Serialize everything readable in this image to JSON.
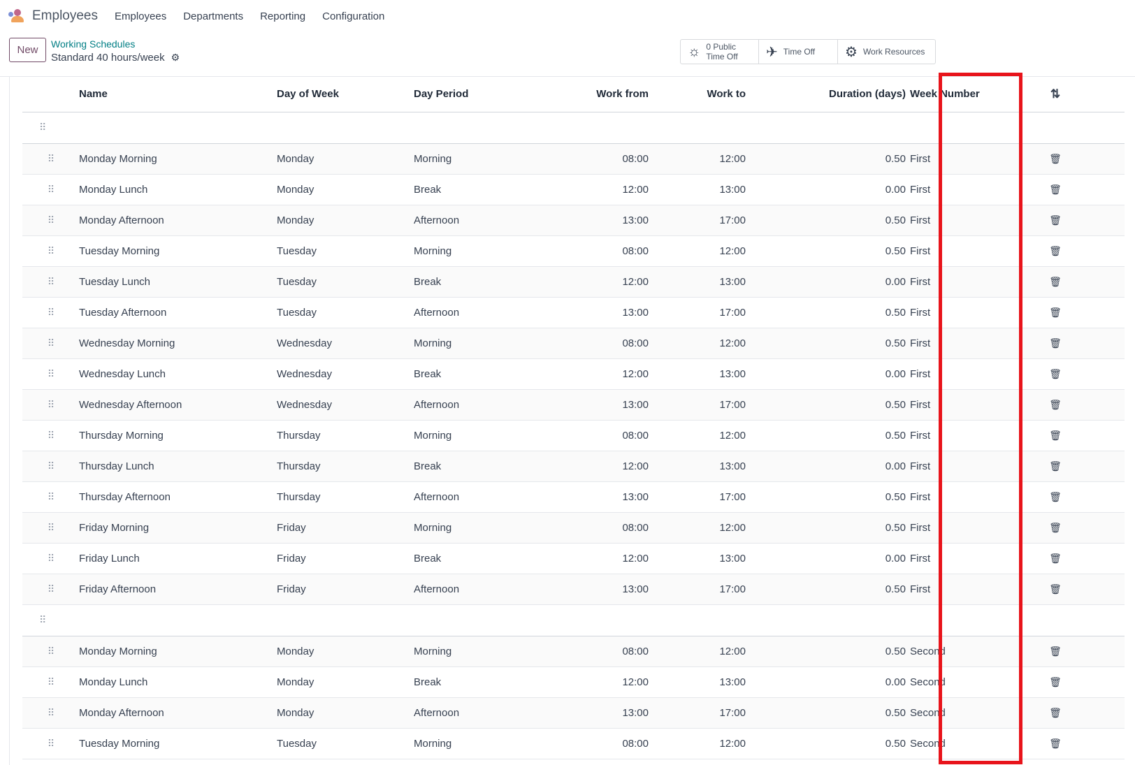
{
  "topnav": {
    "app_icon": "employees-app-icon",
    "app_name": "Employees",
    "menu": [
      "Employees",
      "Departments",
      "Reporting",
      "Configuration"
    ]
  },
  "control_panel": {
    "new_label": "New",
    "breadcrumb_parent": "Working Schedules",
    "breadcrumb_current": "Standard 40 hours/week",
    "smart_buttons": {
      "public_time_off_count": "0",
      "public_time_off_label1": "Public",
      "public_time_off_label2": "Time Off",
      "time_off_label": "Time Off",
      "work_resources_label": "Work Resources"
    }
  },
  "table": {
    "headers": [
      "Name",
      "Day of Week",
      "Day Period",
      "Work from",
      "Work to",
      "Duration (days)",
      "Week Number"
    ],
    "rows": [
      {
        "section": true
      },
      {
        "name": "Monday Morning",
        "day": "Monday",
        "period": "Morning",
        "from": "08:00",
        "to": "12:00",
        "duration": "0.50",
        "week": "First"
      },
      {
        "name": "Monday Lunch",
        "day": "Monday",
        "period": "Break",
        "from": "12:00",
        "to": "13:00",
        "duration": "0.00",
        "week": "First"
      },
      {
        "name": "Monday Afternoon",
        "day": "Monday",
        "period": "Afternoon",
        "from": "13:00",
        "to": "17:00",
        "duration": "0.50",
        "week": "First"
      },
      {
        "name": "Tuesday Morning",
        "day": "Tuesday",
        "period": "Morning",
        "from": "08:00",
        "to": "12:00",
        "duration": "0.50",
        "week": "First"
      },
      {
        "name": "Tuesday Lunch",
        "day": "Tuesday",
        "period": "Break",
        "from": "12:00",
        "to": "13:00",
        "duration": "0.00",
        "week": "First"
      },
      {
        "name": "Tuesday Afternoon",
        "day": "Tuesday",
        "period": "Afternoon",
        "from": "13:00",
        "to": "17:00",
        "duration": "0.50",
        "week": "First"
      },
      {
        "name": "Wednesday Morning",
        "day": "Wednesday",
        "period": "Morning",
        "from": "08:00",
        "to": "12:00",
        "duration": "0.50",
        "week": "First"
      },
      {
        "name": "Wednesday Lunch",
        "day": "Wednesday",
        "period": "Break",
        "from": "12:00",
        "to": "13:00",
        "duration": "0.00",
        "week": "First"
      },
      {
        "name": "Wednesday Afternoon",
        "day": "Wednesday",
        "period": "Afternoon",
        "from": "13:00",
        "to": "17:00",
        "duration": "0.50",
        "week": "First"
      },
      {
        "name": "Thursday Morning",
        "day": "Thursday",
        "period": "Morning",
        "from": "08:00",
        "to": "12:00",
        "duration": "0.50",
        "week": "First"
      },
      {
        "name": "Thursday Lunch",
        "day": "Thursday",
        "period": "Break",
        "from": "12:00",
        "to": "13:00",
        "duration": "0.00",
        "week": "First"
      },
      {
        "name": "Thursday Afternoon",
        "day": "Thursday",
        "period": "Afternoon",
        "from": "13:00",
        "to": "17:00",
        "duration": "0.50",
        "week": "First"
      },
      {
        "name": "Friday Morning",
        "day": "Friday",
        "period": "Morning",
        "from": "08:00",
        "to": "12:00",
        "duration": "0.50",
        "week": "First"
      },
      {
        "name": "Friday Lunch",
        "day": "Friday",
        "period": "Break",
        "from": "12:00",
        "to": "13:00",
        "duration": "0.00",
        "week": "First"
      },
      {
        "name": "Friday Afternoon",
        "day": "Friday",
        "period": "Afternoon",
        "from": "13:00",
        "to": "17:00",
        "duration": "0.50",
        "week": "First"
      },
      {
        "section": true
      },
      {
        "name": "Monday Morning",
        "day": "Monday",
        "period": "Morning",
        "from": "08:00",
        "to": "12:00",
        "duration": "0.50",
        "week": "Second"
      },
      {
        "name": "Monday Lunch",
        "day": "Monday",
        "period": "Break",
        "from": "12:00",
        "to": "13:00",
        "duration": "0.00",
        "week": "Second"
      },
      {
        "name": "Monday Afternoon",
        "day": "Monday",
        "period": "Afternoon",
        "from": "13:00",
        "to": "17:00",
        "duration": "0.50",
        "week": "Second"
      },
      {
        "name": "Tuesday Morning",
        "day": "Tuesday",
        "period": "Morning",
        "from": "08:00",
        "to": "12:00",
        "duration": "0.50",
        "week": "Second"
      }
    ]
  },
  "icons": {
    "handle": "⠿",
    "trash": "🗑",
    "settings": "⇆"
  },
  "colors": {
    "brand": "#714b67",
    "link": "#017e84",
    "highlight": "#e8141b"
  }
}
